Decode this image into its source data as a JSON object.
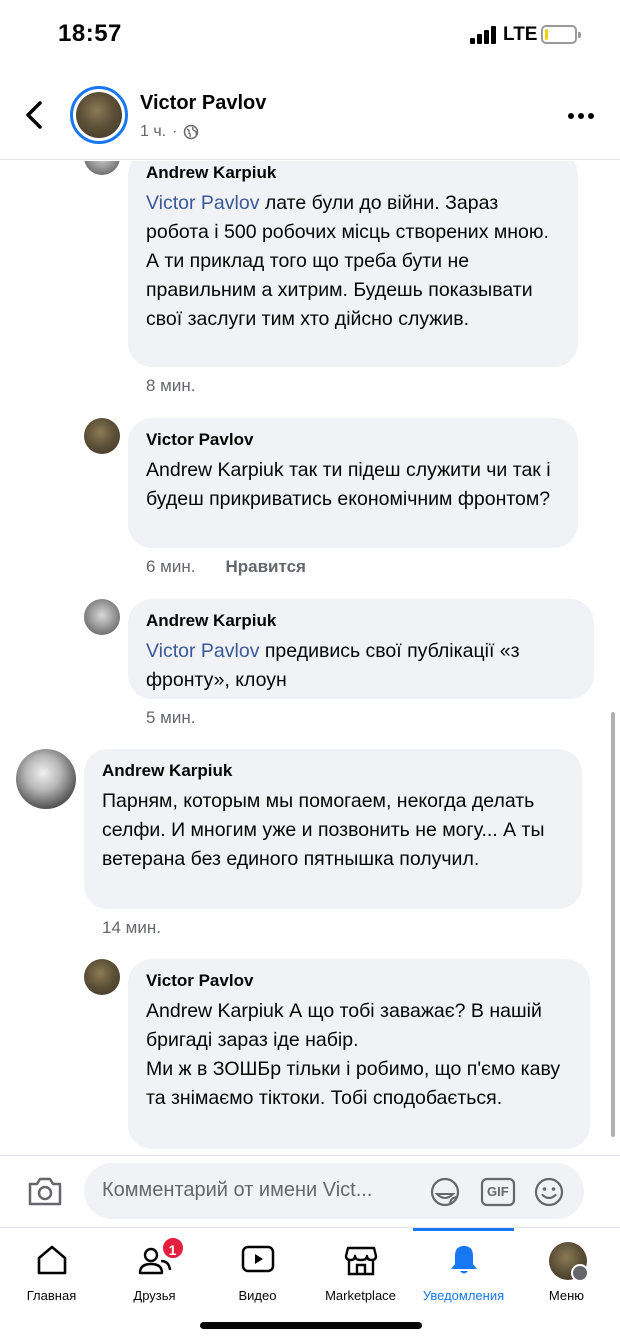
{
  "status_bar": {
    "time": "18:57",
    "network": "LTE",
    "battery_percent": 12
  },
  "header": {
    "author": "Victor Pavlov",
    "time": "1 ч.",
    "separator": "·",
    "icons": {
      "back": "chevron-left-icon",
      "audience": "globe-icon",
      "more": "more-horizontal-icon"
    }
  },
  "comments": [
    {
      "author": "Andrew Karpiuk",
      "mention": "Victor Pavlov",
      "text": " лате були до війни. Зараз робота і 500 робочих місць створених мною. А ти приклад того що треба бути не правильним а хитрим. Будешь показывати свої заслуги тим хто дійсно служив.",
      "time": "8 мин.",
      "like": ""
    },
    {
      "author": "Victor Pavlov",
      "mention": "",
      "text": "Andrew Karpiuk так ти підеш служити чи так і будеш прикриватись економічним фронтом?",
      "time": "6 мин.",
      "like": "Нравится"
    },
    {
      "author": "Andrew Karpiuk",
      "mention": "Victor Pavlov",
      "text": " предивись свої публікації «з фронту», клоун",
      "time": "5 мин.",
      "like": ""
    },
    {
      "author": "Andrew Karpiuk",
      "mention": "",
      "text": "Парням, которым мы помогаем, некогда делать селфи. И многим уже и позвонить не могу... А ты ветерана без единого пятнышка получил.",
      "time": "14 мин.",
      "like": ""
    },
    {
      "author": "Victor Pavlov",
      "mention": "",
      "text": "Andrew Karpiuk А що тобі заважає? В нашій бригаді зараз іде набір.\nМи ж в ЗОШБр тільки і робимо, що п'ємо каву та знімаємо тіктоки. Тобі сподобається.",
      "time": "",
      "like": ""
    }
  ],
  "composer": {
    "placeholder": "Комментарий от имени Vict...",
    "gif_label": "GIF"
  },
  "tabs": [
    {
      "label": "Главная",
      "icon": "home-icon",
      "badge": ""
    },
    {
      "label": "Друзья",
      "icon": "friends-icon",
      "badge": "1"
    },
    {
      "label": "Видео",
      "icon": "video-icon",
      "badge": ""
    },
    {
      "label": "Marketplace",
      "icon": "marketplace-icon",
      "badge": ""
    },
    {
      "label": "Уведомления",
      "icon": "bell-icon",
      "badge": ""
    },
    {
      "label": "Меню",
      "icon": "menu-avatar-icon",
      "badge": ""
    }
  ],
  "colors": {
    "accent": "#1877f2",
    "mention": "#385898",
    "bubble": "#f0f2f5",
    "badge": "#e41e3f",
    "meta": "#65676b"
  }
}
